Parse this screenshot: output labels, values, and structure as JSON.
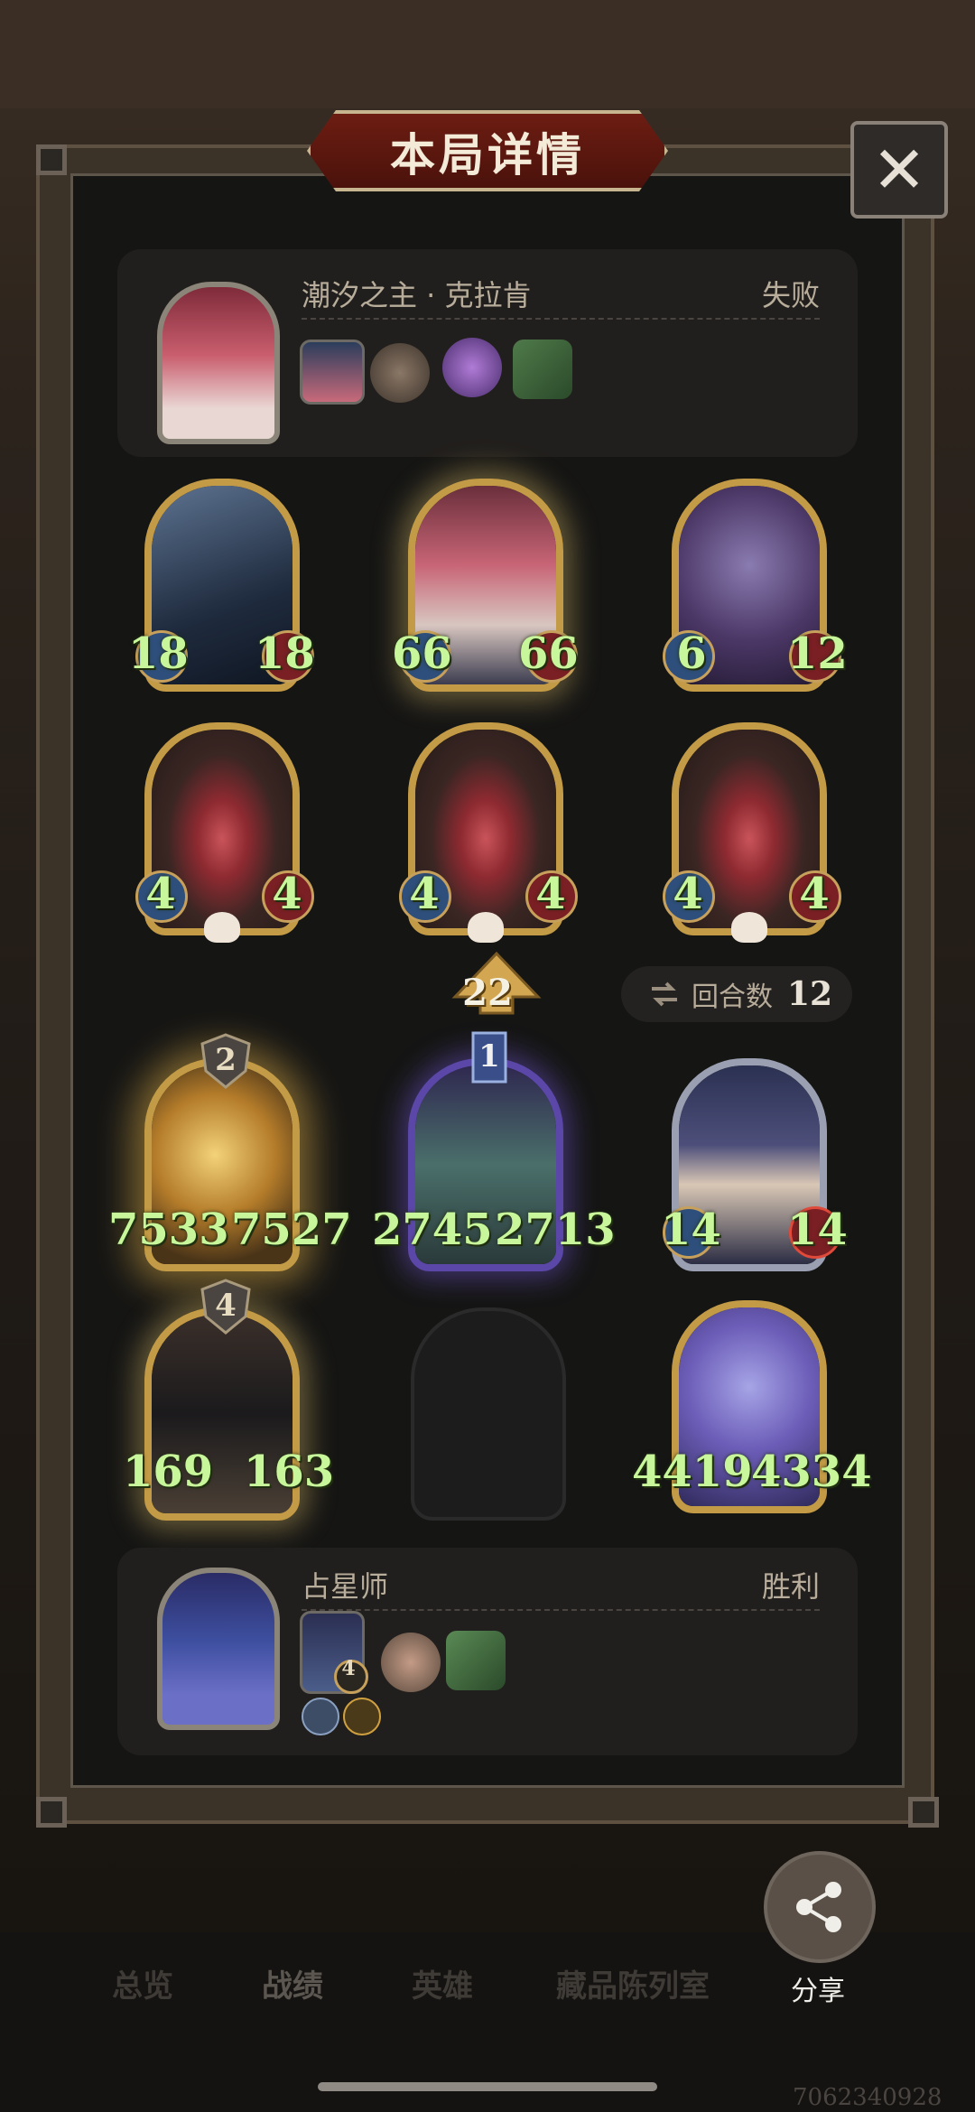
{
  "dialog": {
    "title": "本局详情",
    "close_label": "✕"
  },
  "opponent": {
    "name": "潮汐之主 · 克拉肯",
    "result": "失败"
  },
  "player": {
    "name": "占星师",
    "result": "胜利",
    "hero_level": "4"
  },
  "round": {
    "label": "回合数",
    "value": "12"
  },
  "opponent_board": [
    {
      "atk": "18",
      "hp": "18"
    },
    {
      "atk": "66",
      "hp": "66"
    },
    {
      "atk": "6",
      "hp": "12"
    },
    {
      "atk": "4",
      "hp": "4"
    },
    {
      "atk": "4",
      "hp": "4"
    },
    {
      "atk": "4",
      "hp": "4"
    }
  ],
  "player_board": [
    {
      "atk": "7533",
      "hp": "7527",
      "tier": "2"
    },
    {
      "atk": "2745",
      "hp": "2713",
      "tier": "1"
    },
    {
      "atk": "14",
      "hp": "14"
    },
    {
      "atk": "169",
      "hp": "163",
      "tier": "4"
    },
    {
      "atk": "4419",
      "hp": "4334"
    }
  ],
  "upgrade_count": "22",
  "nav": {
    "items": [
      "总览",
      "战绩",
      "英雄",
      "藏品陈列室"
    ],
    "share": "分享"
  },
  "watermark": "7062340928",
  "colors": {
    "stat_green": "#c8f69a",
    "panel": "#151514",
    "title_plate": "#6d1d12"
  }
}
